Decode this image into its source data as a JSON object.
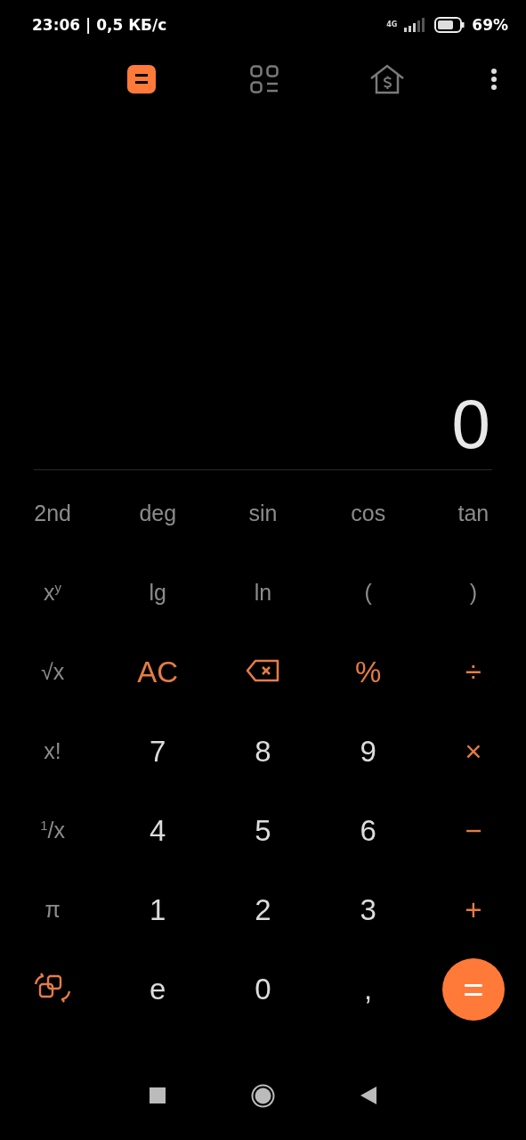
{
  "status_bar": {
    "time": "23:06 | 0,5 КБ/с",
    "network": "4G",
    "battery": "69%"
  },
  "tabs": [
    {
      "kind": "calculator",
      "selected": true
    },
    {
      "kind": "converter",
      "selected": false
    },
    {
      "kind": "finance",
      "selected": false
    }
  ],
  "display": {
    "value": "0"
  },
  "keypad": [
    [
      {
        "kind": "function",
        "label": "2nd"
      },
      {
        "kind": "function",
        "label": "deg"
      },
      {
        "kind": "function",
        "label": "sin"
      },
      {
        "kind": "function",
        "label": "cos"
      },
      {
        "kind": "function",
        "label": "tan"
      }
    ],
    [
      {
        "kind": "function",
        "label": "x$^{y}$"
      },
      {
        "kind": "function",
        "label": "lg"
      },
      {
        "kind": "function",
        "label": "ln"
      },
      {
        "kind": "function",
        "label": "("
      },
      {
        "kind": "function",
        "label": ")"
      }
    ],
    [
      {
        "kind": "function",
        "label": "√x"
      },
      {
        "kind": "operator",
        "label": "AC"
      },
      {
        "kind": "backspace"
      },
      {
        "kind": "operator",
        "label": "%"
      },
      {
        "kind": "operator",
        "label": "÷"
      }
    ],
    [
      {
        "kind": "function",
        "label": "x!"
      },
      {
        "kind": "digit",
        "label": "7"
      },
      {
        "kind": "digit",
        "label": "8"
      },
      {
        "kind": "digit",
        "label": "9"
      },
      {
        "kind": "operator",
        "label": "×"
      }
    ],
    [
      {
        "kind": "function",
        "label": "$^{1}$/x"
      },
      {
        "kind": "digit",
        "label": "4"
      },
      {
        "kind": "digit",
        "label": "5"
      },
      {
        "kind": "digit",
        "label": "6"
      },
      {
        "kind": "operator",
        "label": "−"
      }
    ],
    [
      {
        "kind": "function",
        "label": "π"
      },
      {
        "kind": "digit",
        "label": "1"
      },
      {
        "kind": "digit",
        "label": "2"
      },
      {
        "kind": "digit",
        "label": "3"
      },
      {
        "kind": "operator",
        "label": "+"
      }
    ],
    [
      {
        "kind": "switch"
      },
      {
        "kind": "digit",
        "label": "e"
      },
      {
        "kind": "digit",
        "label": "0"
      },
      {
        "kind": "digit",
        "label": ","
      },
      {
        "kind": "equals",
        "label": "="
      }
    ]
  ]
}
